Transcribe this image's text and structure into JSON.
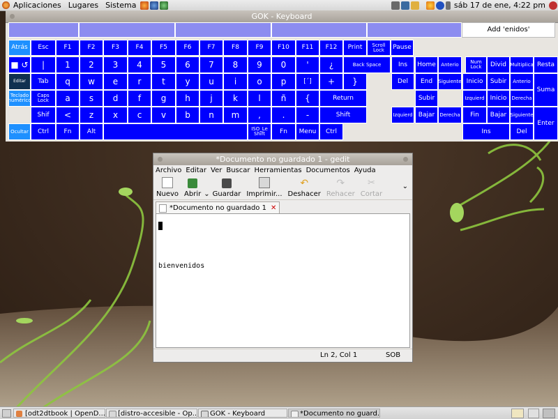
{
  "top_panel": {
    "menus": [
      "Aplicaciones",
      "Lugares",
      "Sistema"
    ],
    "clock": "sáb 17 de ene,  4:22 pm"
  },
  "gok": {
    "title": "GOK - Keyboard",
    "word_completion": "Add 'enidos'",
    "keys": {
      "atras": "Atrás",
      "esc": "Esc",
      "f1": "F1",
      "f2": "F2",
      "f3": "F3",
      "f4": "F4",
      "f5": "F5",
      "f6": "F6",
      "f7": "F7",
      "f8": "F8",
      "f9": "F9",
      "f10": "F10",
      "f11": "F11",
      "f12": "F12",
      "print": "Print",
      "scroll_lock": "Scroll Lock",
      "pause": "Pause",
      "repeat": "■ ↺",
      "pipe": "|",
      "n1": "1",
      "n2": "2",
      "n3": "3",
      "n4": "4",
      "n5": "5",
      "n6": "6",
      "n7": "7",
      "n8": "8",
      "n9": "9",
      "n0": "0",
      "apos": "'",
      "iquest": "¿",
      "backspace": "Back Space",
      "ins": "Ins",
      "home": "Home",
      "anterior": "Anterio",
      "numlock": "Num Lock",
      "divid": "Divid",
      "multiplica": "Multiplica",
      "resta": "Resta",
      "editar": "Editar",
      "tab": "Tab",
      "q": "q",
      "w": "w",
      "e": "e",
      "r": "r",
      "t": "t",
      "y": "y",
      "u": "u",
      "i": "i",
      "o": "o",
      "p": "p",
      "acute": "[´]",
      "plus": "+",
      "rbrace": "}",
      "del": "Del",
      "end": "End",
      "siguiente": "Siguiente",
      "inicio": "Inicio",
      "subir": "Subir",
      "anterior2": "Anterio",
      "suma": "Suma",
      "teclado_num": "Teclado numérico",
      "caps_lock": "Caps Lock",
      "a": "a",
      "s": "s",
      "d": "d",
      "f": "f",
      "g": "g",
      "h": "h",
      "j": "j",
      "k": "k",
      "l": "l",
      "ntilde": "ñ",
      "lbrace": "{",
      "return": "Return",
      "subir_arrow": "Subir",
      "izquierda_kp": "Izquierd",
      "inicio_kp": "Inicio",
      "derecha_kp": "Derecha",
      "shift_l": "Shif",
      "lt": "<",
      "z": "z",
      "x": "x",
      "c": "c",
      "v": "v",
      "b": "b",
      "n": "n",
      "m": "m",
      "comma": ",",
      "period": ".",
      "minus": "-",
      "shift_r": "Shift",
      "izquierda": "Izquierd",
      "bajar": "Bajar",
      "derecha": "Derecha",
      "fin_kp": "Fin",
      "bajar_kp": "Bajar",
      "siguiente_kp": "Siguiente",
      "enter_kp": "Enter",
      "ocultar": "Ocultar",
      "ctrl_l": "Ctrl",
      "fn_l": "Fn",
      "alt": "Alt",
      "iso_shift": "ISO_Le Shift",
      "fn_r": "Fn",
      "menu": "Menu",
      "ctrl_r": "Ctrl",
      "ins_kp": "Ins",
      "del_kp": "Del"
    }
  },
  "gedit": {
    "title": "*Documento no guardado 1 - gedit",
    "menus": [
      "Archivo",
      "Editar",
      "Ver",
      "Buscar",
      "Herramientas",
      "Documentos",
      "Ayuda"
    ],
    "toolbar": {
      "nuevo": "Nuevo",
      "abrir": "Abrir",
      "guardar": "Guardar",
      "imprimir": "Imprimir...",
      "deshacer": "Deshacer",
      "rehacer": "Rehacer",
      "cortar": "Cortar"
    },
    "tab_label": "*Documento no guardado 1",
    "content_line": "bienvenidos",
    "status_position": "Ln 2, Col 1",
    "status_mode": "SOB"
  },
  "taskbar": {
    "tasks": [
      "[odt2dtbook | OpenD...",
      "[distro-accesible - Op...",
      "GOK - Keyboard",
      "*Documento no guard..."
    ]
  },
  "colors": {
    "key_blue": "#0000ff",
    "key_cyan": "#1e90ff",
    "key_dark": "#103050",
    "key_pale": "#8c8cf0",
    "wallpaper": "#3a2a1d"
  }
}
